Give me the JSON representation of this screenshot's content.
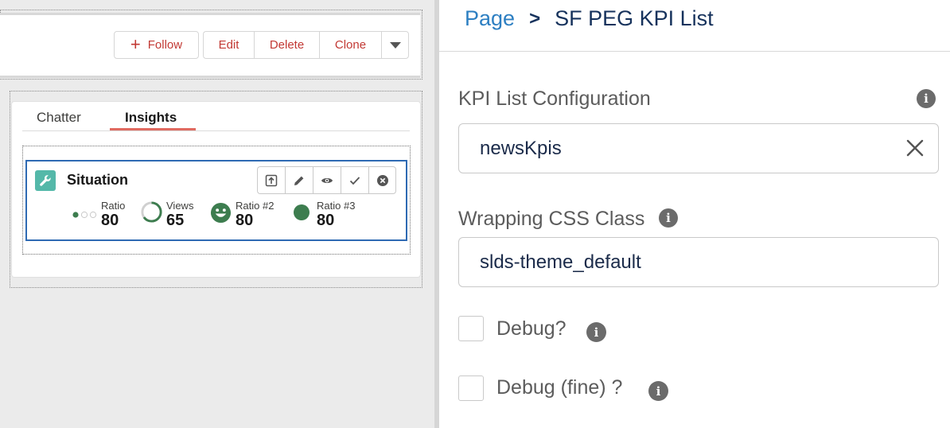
{
  "record_header": {
    "follow_label": "Follow",
    "actions": [
      "Edit",
      "Delete",
      "Clone"
    ]
  },
  "tabs": [
    {
      "label": "Chatter",
      "active": false
    },
    {
      "label": "Insights",
      "active": true
    }
  ],
  "kpi_card": {
    "title": "Situation",
    "icon": "wrench-icon",
    "actions": [
      "export-icon",
      "edit-icon",
      "view-icon",
      "check-icon",
      "close-circle-icon"
    ],
    "kpis": [
      {
        "label": "Ratio",
        "value": "80",
        "icon": "progress-dots-icon"
      },
      {
        "label": "Views",
        "value": "65",
        "icon": "progress-ring-icon"
      },
      {
        "label": "Ratio #2",
        "value": "80",
        "icon": "smiley-icon"
      },
      {
        "label": "Ratio #3",
        "value": "80",
        "icon": "status-dot-icon"
      }
    ]
  },
  "panel": {
    "breadcrumb_page": "Page",
    "breadcrumb_separator": ">",
    "breadcrumb_current": "SF PEG KPI List",
    "kpi_config_label": "KPI List Configuration",
    "kpi_config_value": "newsKpis",
    "css_class_label": "Wrapping CSS Class",
    "css_class_value": "slds-theme_default",
    "debug_label": "Debug?",
    "debug_checked": false,
    "debug_fine_label": "Debug (fine) ?",
    "debug_fine_checked": false
  },
  "colors": {
    "action_text": "#c23934",
    "card_border": "#2e6ab3",
    "wrench_bg": "#54b8a9",
    "kpi_green": "#3d7d4f",
    "tab_underline": "#e06a60",
    "breadcrumb_link": "#2d7fc2",
    "breadcrumb_text": "#16325c"
  }
}
